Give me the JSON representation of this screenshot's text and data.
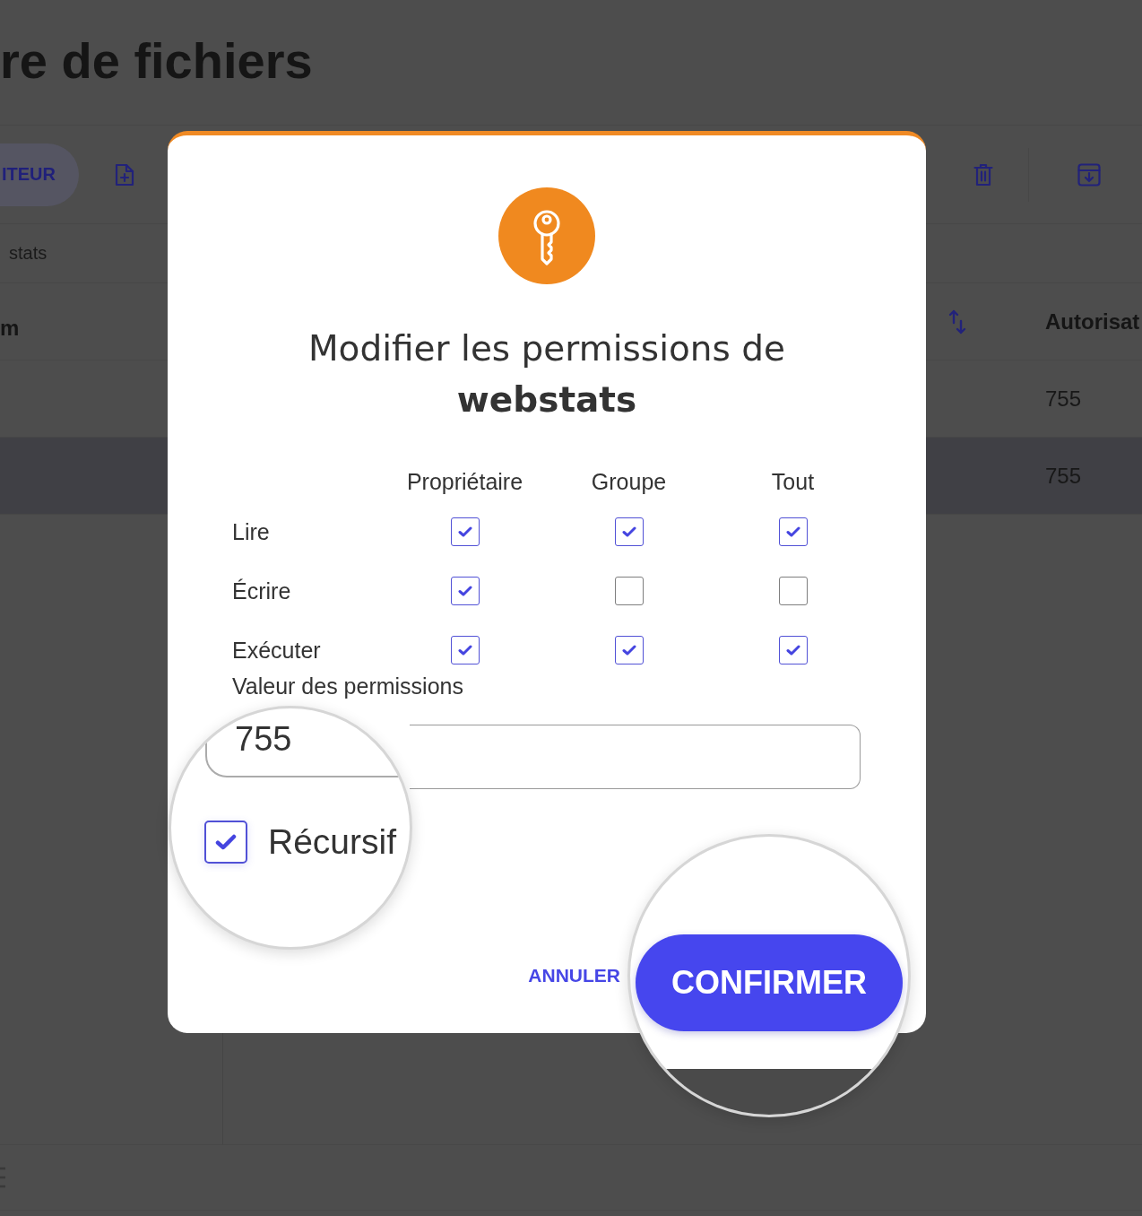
{
  "page": {
    "title": "re de fichiers"
  },
  "toolbar": {
    "button": {
      "label": "ITEUR"
    }
  },
  "breadcrumb": {
    "label": "stats"
  },
  "table": {
    "columns": [
      {
        "label": "m"
      },
      {
        "label": "Autorisat"
      }
    ],
    "rows": [
      {
        "permissions": "755",
        "selected": false
      },
      {
        "permissions": "755",
        "selected": true
      }
    ]
  },
  "dialog": {
    "title": "Modifier les permissions de **webstats**",
    "columns": [
      "Propriétaire",
      "Groupe",
      "Tout"
    ],
    "permissions": [
      {
        "label": "Lire",
        "checks": [
          {
            "checked": true
          },
          {
            "checked": true
          },
          {
            "checked": true
          }
        ]
      },
      {
        "label": "Écrire",
        "checks": [
          {
            "checked": true
          },
          {
            "checked": false
          },
          {
            "checked": false
          }
        ]
      },
      {
        "label": "Exécuter",
        "checks": [
          {
            "checked": true
          },
          {
            "checked": true
          },
          {
            "checked": true
          }
        ]
      }
    ],
    "value_field": {
      "label": "Valeur des permissions",
      "value": "755"
    },
    "recursive": {
      "label": "Récursif",
      "checked": true
    },
    "buttons": [
      {
        "kind": "text",
        "label": "ANNULER"
      },
      {
        "kind": "primary",
        "label": "CONFIRMER"
      }
    ]
  }
}
